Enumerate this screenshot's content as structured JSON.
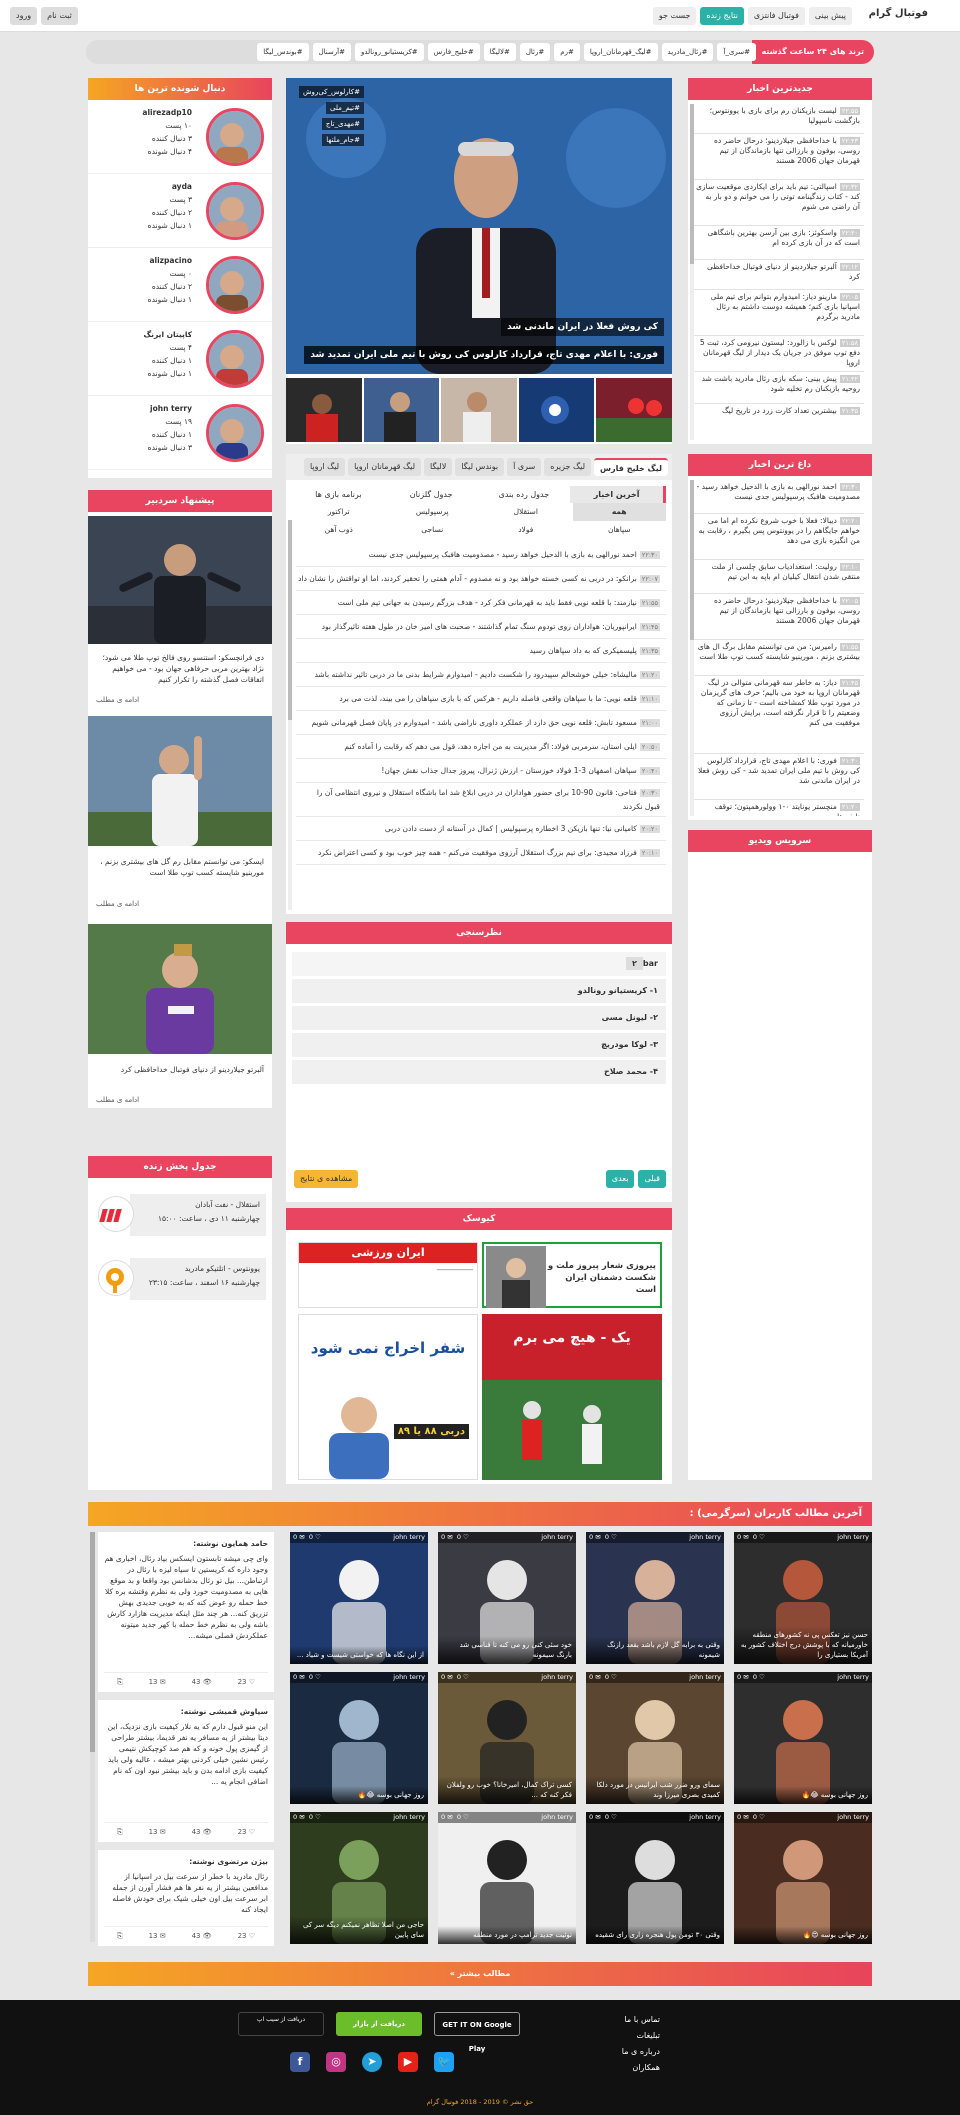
{
  "header": {
    "brand": "فوتبال گرام",
    "nav": [
      "پیش بینی",
      "فوتبال فانتزی",
      "نتایج زنده",
      "جست جو"
    ],
    "auth": [
      "ورود",
      "ثبت نام"
    ]
  },
  "trends": {
    "title": "ترند های ۲۴ ساعت گذشته",
    "tags": [
      "#سری_آ",
      "#رئال_مادرید",
      "#لیگ_قهرمانان_اروپا",
      "#رم",
      "#رئال",
      "#لالیگا",
      "#خلیج_فارس",
      "#کریستیانو_رونالدو",
      "#آرسنال",
      "#بوندس_لیگا"
    ]
  },
  "latest": {
    "title": "جدیدترین اخبار",
    "items": [
      {
        "time": "۲۲:۵۵",
        "text": "لیست بازیکنان رم برای بازی با یوونتوس؛ بازگشت ناسپولیا"
      },
      {
        "time": "۲۲:۴۳",
        "text": "با خداحافظی جیلاردینو؛ درحال حاضر ده روسی، بوفون و بارزالی تنها بازماندگان از تیم قهرمان جهان 2006 هستند"
      },
      {
        "time": "۲۲:۳۲",
        "text": "اسپالتی: تیم باید برای ایکاردی موقعیت سازی کند - کتاب زندگینامه توتی را می خوانم و دو بار به آن راضی می شوم"
      },
      {
        "time": "۲۲:۲۰",
        "text": "واسکوئز: بازی بین آرسن بهترین باشگاهی است که در آن بازی کرده ام"
      },
      {
        "time": "۲۲:۱۲",
        "text": "آلبرتو جیلاردینو از دنیای فوتبال خداحافظی کرد"
      },
      {
        "time": "۲۲:۰۵",
        "text": "مارینو دیاز: امیدوارم بتوانم برای تیم ملی اسپانیا بازی کنم؛ همیشه دوست داشتم به رئال مادرید برگردم"
      },
      {
        "time": "۲۱:۵۸",
        "text": "لوکس با زالورد: لیستون نیرومی کرد، ثبت 5 دفع توپ موفق در جریان یک دیدار از لیگ قهرمانان اروپا"
      },
      {
        "time": "۲۱:۴۲",
        "text": "پیش بینی: سکه بازی رئال مادرید باشت شد روحیه بازیکنان رم تخلیه شود"
      },
      {
        "time": "۲۱:۳۵",
        "text": "بیشترین تعداد کارت زرد در تاریخ لیگ"
      }
    ]
  },
  "hottest": {
    "title": "داغ ترین اخبار",
    "items": [
      {
        "time": "۲۲:۳۰",
        "text": "احمد نورالهی به بازی با الدحیل خواهد رسید - مصدومیت هافبک پرسپولیس جدی نیست"
      },
      {
        "time": "۲۲:۲۰",
        "text": "دیبالا: فعلا با خوب شروع نکرده ام اما می خواهم جایگاهم را در یوونتوس پس بگیرم ، رقابت به من انگیزه بازی می دهد"
      },
      {
        "time": "۲۲:۱۰",
        "text": "رولیت: استعدادیاب سابق چلسی از ملت منتقی شدن انتقال کیلیان ام باپه به این تیم"
      },
      {
        "time": "۲۲:۰۵",
        "text": "با خداحافظی جیلاردینو؛ درحال حاضر ده روسی، بوفون و بارزالی تنها بازماندگان از تیم قهرمان جهان 2006 هستند"
      },
      {
        "time": "۲۱:۵۵",
        "text": "رامیرس: من می توانستم مقابل برگ ال های بیشتری بزنم ، مورینیو شایسته کسب توپ طلا است"
      },
      {
        "time": "۲۱:۴۵",
        "text": "دیاز: به خاطر سه قهرمانی متوالی در لیگ قهرمانان اروپا به خود می بالیم؛ حرف های گریزمان در مورد توپ طلا کمشاخته است - تا زمانی که وضعیتم را تا قرار نگرفته است، برایش آرزوی موفقیت می کنم"
      },
      {
        "time": "۲۱:۳۰",
        "text": "فوری: با اعلام مهدی تاج، قرارداد کارلوس کی روش با تیم ملی ایران تمدید شد - کی روش فعلا در ایران ماندنی شد"
      },
      {
        "time": "۲۱:۲۰",
        "text": "منچستر یونایتد ۰-۱ وولورهمپتون؛ توقف ناپذیرها"
      }
    ]
  },
  "video": {
    "title": "سرویس ویدیو"
  },
  "followed": {
    "title": "دنبال شونده ترین ها",
    "people": [
      {
        "name": "alirezadp10",
        "posts": "۱۰ پست",
        "followers": "۳ دنبال کننده",
        "following": "۴ دنبال شونده"
      },
      {
        "name": "ayda",
        "posts": "۳ پست",
        "followers": "۲ دنبال کننده",
        "following": "۱ دنبال شونده"
      },
      {
        "name": "alizpacino",
        "posts": "۰ پست",
        "followers": "۲ دنبال کننده",
        "following": "۱ دنبال شونده"
      },
      {
        "name": "کاپیتان ایرنگ",
        "posts": "۴ پست",
        "followers": "۱ دنبال کننده",
        "following": "۱ دنبال شونده"
      },
      {
        "name": "john terry",
        "posts": "۱۹ پست",
        "followers": "۱ دنبال کننده",
        "following": "۳ دنبال شونده"
      }
    ]
  },
  "editorial": {
    "title": "پیشنهاد سردبیر",
    "items": [
      {
        "text": "دی فرانچسکو: استنسو روی فالخ توپ طلا می شود؛ نژاد بهترین مربی حرفاهی جهان بود - می خواهیم اتفاقات فصل گذشته را تکرار کنیم",
        "more": "ادامه ی مطلب"
      },
      {
        "text": "ایسکو: می توانستم مقابل رم گل های بیشتری بزنم ، مورینیو شایسته کسب توپ طلا است",
        "more": "ادامه ی مطلب"
      },
      {
        "text": "آلبرتو جیلاردینو از دنیای فوتبال خداحافظی کرد",
        "more": "ادامه ی مطلب"
      }
    ]
  },
  "live": {
    "title": "جدول پخش زنده",
    "matches": [
      {
        "teams": "استقلال - نفت آبادان",
        "info": "چهارشنبه ۱۱ دی ، ساعت: ۱۵:۰۰"
      },
      {
        "teams": "یوونتوس - اتلتیکو مادرید",
        "info": "چهارشنبه ۱۶ اسفند ، ساعت: ۲۳:۱۵"
      }
    ]
  },
  "slider": {
    "tags": [
      "#کارلوس_کی‌روش",
      "#تیم_ملی",
      "#مهدی_تاج",
      "#جام_ملتها"
    ],
    "caption1": "کی روش فعلا در ایران ماندنی شد",
    "caption2": "فوری: با اعلام مهدی تاج، قرارداد کارلوس کی روش با تیم ملی ایران تمدید شد"
  },
  "leagues": {
    "tabs": [
      "لیگ خلیج فارس",
      "لیگ جزیره",
      "سری آ",
      "بوندس لیگا",
      "لالیگا",
      "لیگ قهرمانان اروپا",
      "لیگ اروپا"
    ],
    "subtabs": [
      "آخرین اخبار",
      "جدول رده بندی",
      "جدول گلزنان",
      "برنامه بازی ها"
    ],
    "teams": [
      "همه",
      "استقلال",
      "پرسپولیس",
      "تراکتور",
      "سپاهان",
      "فولاد",
      "نساجی",
      "ذوب آهن"
    ],
    "news": [
      {
        "time": "۲۲:۳۰",
        "text": "احمد نورالهی به بازی با الدحیل خواهد رسید - مصدومیت هافبک پرسپولیس جدی نیست"
      },
      {
        "time": "۲۲:۰۷",
        "text": "برانکو: در دربی نه کسی خسته خواهد بود و نه مصدوم - آدام همتی را تحقیر کردند، اما او تواقتش را نشان داد"
      },
      {
        "time": "۲۱:۵۵",
        "text": "نیازمند: با قلعه نویی فقط باید به قهرمانی فکر کرد - هدف بزرگم رسیدن به جهانی تیم ملی است"
      },
      {
        "time": "۲۱:۴۵",
        "text": "ایرانپوریان: هواداران روی تودوم سنگ تمام گذاشتند - صحبت های امیر خان در طول هفته تاثیرگذار بود"
      },
      {
        "time": "۲۱:۳۵",
        "text": "پلیسمیکری که به داد سپاهان رسید"
      },
      {
        "time": "۲۱:۲۰",
        "text": "مالیشاه: خیلی خوشحالم سپیدرود را شکست دادیم - امیدوارم شرایط بدنی ما در دربی تاثیر نداشته باشد"
      },
      {
        "time": "۲۱:۱۰",
        "text": "قلعه نویی: ما با سپاهان واقعی فاصله داریم - هرکس که با بازی سپاهان را می بیند، لذت می برد"
      },
      {
        "time": "۲۱:۰۰",
        "text": "مسعود تابش: قلعه نویی حق دارد از عملکرد داوری ناراضی باشد - امیدوارم در پایان فصل قهرمانی شویم"
      },
      {
        "time": "۲۰:۵۰",
        "text": "ایلی استان، سرمربی فولاد: اگر مدیریت به من اجازه دهد، قول می دهم که رقابت را آماده کنم"
      },
      {
        "time": "۲۰:۴۰",
        "text": "سپاهان اصفهان 3-1 فولاد خوزستان - ارزش ژنرال، پیروز جدال جذاب نقش جهان!"
      },
      {
        "time": "۲۰:۳۰",
        "text": "فتاحی: قانون 90-10 برای حضور هواداران در دربی ابلاغ شد اما باشگاه استقلال و نیروی انتظامی آن را قبول نکردند"
      },
      {
        "time": "۲۰:۲۰",
        "text": "کامیانی نیا: تنها بازیکن 3 اخطاره پرسپولیس | کمال در آستانه از دست دادن دربی"
      },
      {
        "time": "۲۰:۱۰",
        "text": "فرزاد مجیدی: برای تیم بزرگ استقلال آرزوی موفقیت می‌کنم - همه چیز خوب بود و کسی اعتراض نکرد"
      }
    ]
  },
  "poll": {
    "title": "نظرسنجی",
    "number": "۲",
    "question": "bar",
    "options": [
      "۱- کریستیانو رونالدو",
      "۲- لیونل مسی",
      "۳- لوکا مودریچ",
      "۴- محمد صلاح"
    ],
    "prev": "قبلی",
    "next": "بعدی",
    "results": "مشاهده ی نتایج"
  },
  "kiosk": {
    "title": "کیوسک",
    "papers": [
      {
        "logo": "ایران ورزشی",
        "headline": "پیروزی شعار پیروز ملت و شکست دشمنان ایران است"
      },
      {
        "logo": "",
        "headline": "یک - هیچ می برم"
      },
      {
        "logo": "",
        "headline": "شفر اخراج نمی شود",
        "sub": "دربی ۸۸ یا ۸۹"
      }
    ]
  },
  "usersPosts": {
    "title": "آخرین مطالب کاربران (سرگرمی) :",
    "more": "مطالب بیشتر »",
    "tiles": [
      {
        "user": "john terry",
        "likes": "0",
        "comments": "0",
        "text": "حسن نیز تعکس پی نه کشورهای منطقه خاورمیانه که با پوشش درج اختلاف کشور به آمریکا بستیاری را"
      },
      {
        "user": "john terry",
        "likes": "0",
        "comments": "0",
        "text": "وقتی به برابه گل لازم باشد بقعد رازنگ شیمونه"
      },
      {
        "user": "john terry",
        "likes": "0",
        "comments": "0",
        "text": "خود سئی کنی رو می کنه تا قناسی شد بارنگ سیمونه"
      },
      {
        "user": "john terry",
        "likes": "0",
        "comments": "0",
        "text": "از این نگاه ها که خواستی شیست و شیاد ..."
      },
      {
        "user": "john terry",
        "likes": "0",
        "comments": "0",
        "text": "روز جهانی بوسه 😂🔥"
      },
      {
        "user": "john terry",
        "likes": "0",
        "comments": "0",
        "text": "سمای ورو ضرر شب ایرانیس در مورد دلکا کمیدی بصری میرزا وند"
      },
      {
        "user": "john terry",
        "likes": "0",
        "comments": "0",
        "text": "کسی تراک کمال، امیرخانا؟ خوب رو ولفلان فکر کنه که ..."
      },
      {
        "user": "john terry",
        "likes": "0",
        "comments": "0",
        "text": "روز جهانی بوسه 😂🔥"
      },
      {
        "user": "john terry",
        "likes": "0",
        "comments": "0",
        "text": "روز جهانی بوسه 😍🔥"
      },
      {
        "user": "john terry",
        "likes": "0",
        "comments": "0",
        "text": "وقتی ۳۰ تومن پول هنجره زاری رای شقیده"
      },
      {
        "user": "john terry",
        "likes": "0",
        "comments": "0",
        "text": "توئیت جدید ترامپ در مورد منطقه"
      },
      {
        "user": "john terry",
        "likes": "0",
        "comments": "0",
        "text": "حاجی من اصلا تظاهر نمیکنم دیگه سر کی سای پایین"
      }
    ],
    "comments": [
      {
        "name": "حامد همایون نوشته:",
        "text": "وای چی میشه تابستون ایسکس بیاد رئال، اخباری هم وجود داره که کریستین تا سیاه لیزه با رئال در ارتباطن... بیل تو رئال بدشانس بود واقعا و بد موقع هایی به مصدومیت خورد ولی به نظرم وقتشه بره کلا خط حمله رو عوض کنه که به خوبی جدیدی بهش تزریق کنه... هر چند مثل اینکه مدیریت هازارد کارش باشه ولی به نظرم خط حمله با کهر جدید میتونه عملکردش فصلی میشه...",
        "likes": "23",
        "views": "43",
        "replies": "13"
      },
      {
        "name": "سیاوش قمیشی نوشته:",
        "text": "این منو قبول دارم که یه نلار کیفیت بازی نزدیک، این دیتا بیشتر از یه مسافر یه نفر قدیما، بیشتر طراحی از گیمزی پول خونه و که هم صد کوچیکش نتیمی رئیس نشین خیلی کردنی بهتر میشه ، عالیه ولی باید کیفیت بازی ادامه بدن و باید بیشتر نبود اون که نام اضافی انجام یه ...",
        "likes": "23",
        "views": "43",
        "replies": "13"
      },
      {
        "name": "بیژن مرتضوی نوشته:",
        "text": "رئال مادرید با خطر از سرعت بیل در اسپانیا از مدافعین بیشتر از یه نفر ها هم فشار آورن از جمله ابر سرعت بیل اون خیلی شیک برای خودش فاصله ایجاد کنه",
        "likes": "23",
        "views": "43",
        "replies": "13"
      }
    ]
  },
  "footer": {
    "links": [
      "تماس با ما",
      "تبلیغات",
      "درباره ی ما",
      "همکاران"
    ],
    "stores": [
      "GET IT ON Google Play",
      "دریافت از بازار",
      "دریافت از سیب اپ"
    ],
    "copyright": "حق نشر © 2019 - 2018 فوتبال گرام"
  },
  "colors": {
    "accent": "#ea4560",
    "gradient_from": "#f5a623",
    "gradient_to": "#e8445c",
    "live_button": "#2bb1a7"
  }
}
